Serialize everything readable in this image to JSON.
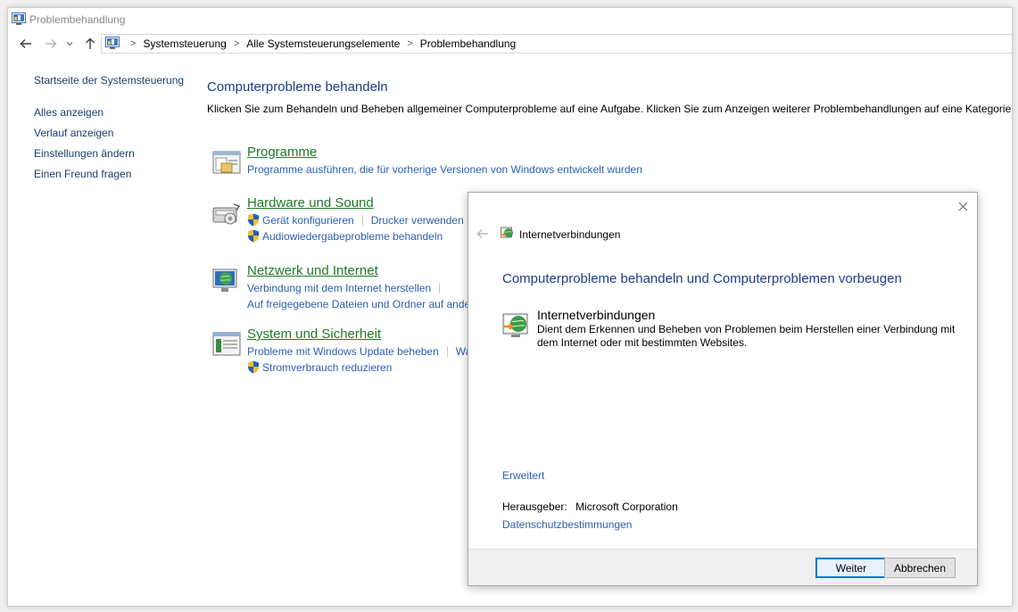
{
  "window": {
    "title": "Problembehandlung",
    "icon": "control-panel-icon"
  },
  "navigation": {
    "back_icon": "arrow-left-icon",
    "forward_icon": "arrow-right-icon",
    "recent_icon": "chevron-down-icon",
    "up_icon": "arrow-up-icon",
    "breadcrumbs": [
      "Systemsteuerung",
      "Alle Systemsteuerungselemente",
      "Problembehandlung"
    ]
  },
  "sidebar": {
    "home": "Startseite der Systemsteuerung",
    "items": [
      "Alles anzeigen",
      "Verlauf anzeigen",
      "Einstellungen ändern",
      "Einen Freund fragen"
    ]
  },
  "main": {
    "heading": "Computerprobleme behandeln",
    "intro": "Klicken Sie zum Behandeln und Beheben allgemeiner Computerprobleme auf eine Aufgabe. Klicken Sie zum Anzeigen weiterer Problembehandlungen auf eine Kategorie, o",
    "categories": [
      {
        "title": "Programme",
        "icon": "programs-icon",
        "link_rows": [
          [
            "Programme ausführen, die für vorherige Versionen von Windows entwickelt wurden"
          ]
        ]
      },
      {
        "title": "Hardware und Sound",
        "icon": "hardware-sound-icon",
        "link_rows": [
          [
            "Gerät konfigurieren",
            "Drucker verwenden"
          ],
          [
            "Audiowiedergabeprobleme behandeln"
          ]
        ]
      },
      {
        "title": "Netzwerk und Internet",
        "icon": "network-internet-icon",
        "link_rows": [
          [
            "Verbindung mit dem Internet herstellen"
          ],
          [
            "Auf freigegebene Dateien und Ordner auf ande"
          ]
        ]
      },
      {
        "title": "System und Sicherheit",
        "icon": "system-security-icon",
        "link_rows": [
          [
            "Probleme mit Windows Update beheben",
            "Wa"
          ],
          [
            "Stromverbrauch reduzieren"
          ]
        ]
      }
    ]
  },
  "dialog": {
    "header_title": "Internetverbindungen",
    "heading": "Computerprobleme behandeln und Computerproblemen vorbeugen",
    "item_title": "Internetverbindungen",
    "item_description": "Dient dem Erkennen und Beheben von Problemen beim Herstellen einer Verbindung mit dem Internet oder mit bestimmten Websites.",
    "advanced_link": "Erweitert",
    "publisher_label": "Herausgeber:",
    "publisher_value": "Microsoft Corporation",
    "privacy_link": "Datenschutzbestimmungen",
    "next_button": "Weiter",
    "cancel_button": "Abbrechen"
  },
  "colors": {
    "link": "#2a5fb0",
    "heading": "#1e3c8c",
    "category_title": "#1c7a26",
    "primary_button_border": "#0078d7"
  }
}
